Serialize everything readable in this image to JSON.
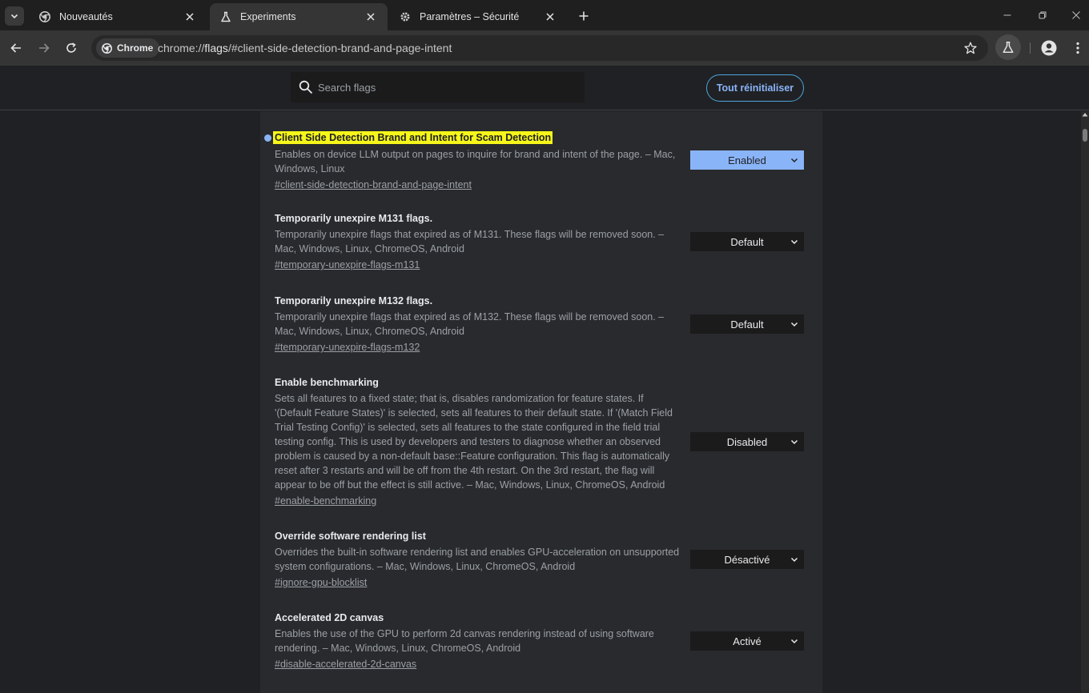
{
  "tabs": [
    {
      "label": "Nouveautés",
      "icon": "chrome-logo-icon",
      "active": false
    },
    {
      "label": "Experiments",
      "icon": "flask-icon",
      "active": true
    },
    {
      "label": "Paramètres – Sécurité",
      "icon": "gear-icon",
      "active": false
    }
  ],
  "omnibox": {
    "chip_label": "Chrome",
    "url_scheme": "chrome://",
    "url_host": "flags",
    "url_path": "/#client-side-detection-brand-and-page-intent"
  },
  "flags_header": {
    "search_placeholder": "Search flags",
    "reset_label": "Tout réinitialiser"
  },
  "flags": [
    {
      "title": "Client Side Detection Brand and Intent for Scam Detection",
      "description": "Enables on device LLM output on pages to inquire for brand and intent of the page. – Mac, Windows, Linux",
      "link": "#client-side-detection-brand-and-page-intent",
      "value": "Enabled",
      "highlighted": true
    },
    {
      "title": "Temporarily unexpire M131 flags.",
      "description": "Temporarily unexpire flags that expired as of M131. These flags will be removed soon. – Mac, Windows, Linux, ChromeOS, Android",
      "link": "#temporary-unexpire-flags-m131",
      "value": "Default"
    },
    {
      "title": "Temporarily unexpire M132 flags.",
      "description": "Temporarily unexpire flags that expired as of M132. These flags will be removed soon. – Mac, Windows, Linux, ChromeOS, Android",
      "link": "#temporary-unexpire-flags-m132",
      "value": "Default"
    },
    {
      "title": "Enable benchmarking",
      "description": "Sets all features to a fixed state; that is, disables randomization for feature states. If '(Default Feature States)' is selected, sets all features to their default state. If '(Match Field Trial Testing Config)' is selected, sets all features to the state configured in the field trial testing config. This is used by developers and testers to diagnose whether an observed problem is caused by a non-default base::Feature configuration. This flag is automatically reset after 3 restarts and will be off from the 4th restart. On the 3rd restart, the flag will appear to be off but the effect is still active. – Mac, Windows, Linux, ChromeOS, Android",
      "link": "#enable-benchmarking",
      "value": "Disabled"
    },
    {
      "title": "Override software rendering list",
      "description": "Overrides the built-in software rendering list and enables GPU-acceleration on unsupported system configurations. – Mac, Windows, Linux, ChromeOS, Android",
      "link": "#ignore-gpu-blocklist",
      "value": "Désactivé"
    },
    {
      "title": "Accelerated 2D canvas",
      "description": "Enables the use of the GPU to perform 2d canvas rendering instead of using software rendering. – Mac, Windows, Linux, ChromeOS, Android",
      "link": "#disable-accelerated-2d-canvas",
      "value": "Activé"
    }
  ],
  "colors": {
    "accent": "#8ab4f8",
    "highlight": "#f6f61a",
    "panel": "#292a2d",
    "background": "#202124"
  }
}
